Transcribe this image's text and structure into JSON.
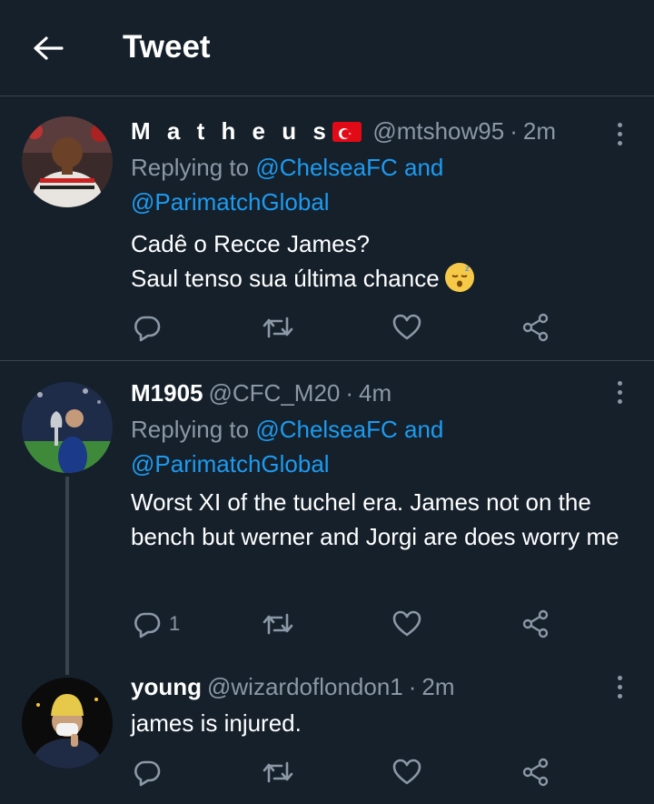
{
  "header": {
    "title": "Tweet"
  },
  "tweets": [
    {
      "name": "M a t h e u s",
      "handle": "@mtshow95",
      "dot": "·",
      "time": "2m",
      "replying_prefix": "Replying to",
      "replying_first": "@ChelseaFC and",
      "replying_second": "@ParimatchGlobal",
      "line1": "Cadê o Recce James?",
      "line2": "Saul tenso sua última chance",
      "reply_count": ""
    },
    {
      "name": "M1905",
      "handle": "@CFC_M20",
      "dot": "·",
      "time": "4m",
      "replying_prefix": "Replying to",
      "replying_first": "@ChelseaFC and",
      "replying_second": "@ParimatchGlobal",
      "text": "Worst XI of the tuchel era. James not on the bench but werner and Jorgi are does worry me",
      "reply_count": "1"
    },
    {
      "name": "young",
      "handle": "@wizardoflondon1",
      "dot": "·",
      "time": "2m",
      "text": "james is injured.",
      "reply_count": ""
    }
  ],
  "colors": {
    "background": "#15202b",
    "link": "#1d9bf0",
    "secondary_text": "#8b98a5",
    "divider": "#38444d"
  }
}
